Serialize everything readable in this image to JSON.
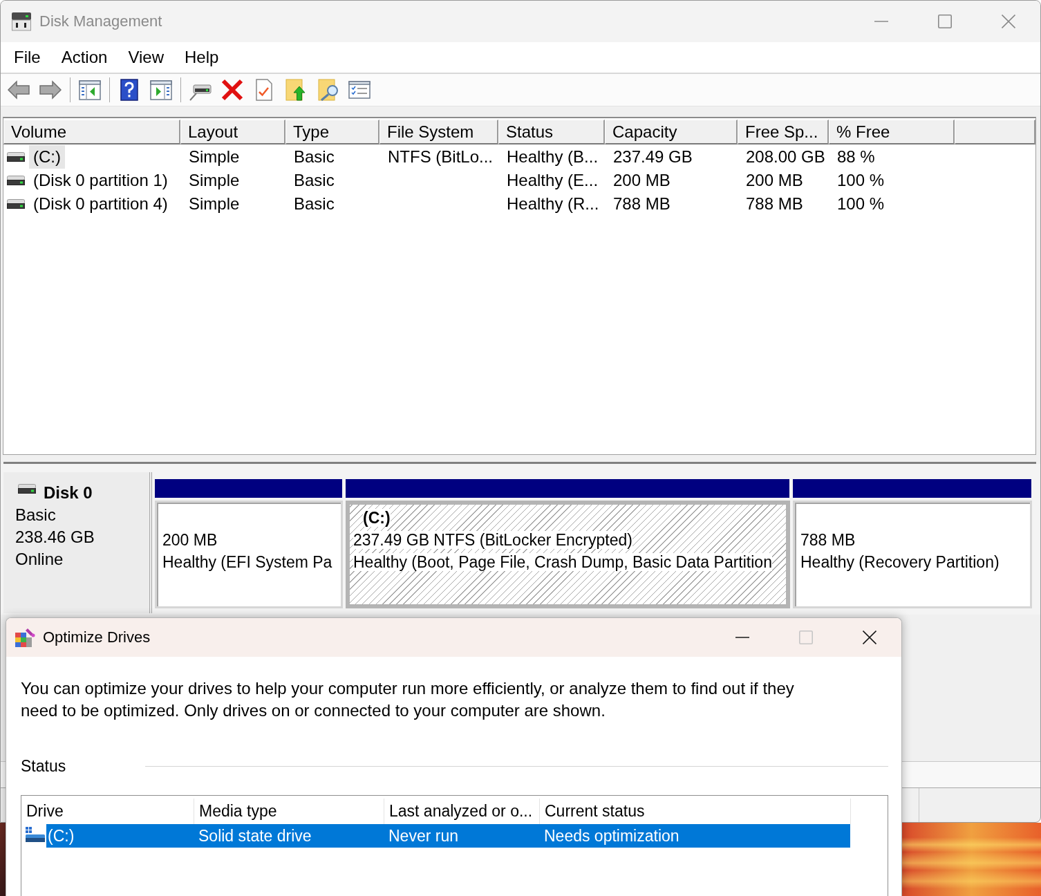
{
  "disk_management": {
    "title": "Disk Management",
    "active": false,
    "caption_buttons": [
      {
        "kind": "minimize",
        "disabled": false
      },
      {
        "kind": "maximize",
        "disabled": false
      },
      {
        "kind": "close",
        "disabled": false
      }
    ],
    "menu": [
      "File",
      "Action",
      "View",
      "Help"
    ],
    "toolbar": [
      [
        {
          "kind": "back",
          "disabled": true
        },
        {
          "kind": "forward",
          "disabled": true
        }
      ],
      [
        {
          "kind": "show-tree",
          "disabled": false
        }
      ],
      [
        {
          "kind": "help",
          "disabled": false
        },
        {
          "kind": "action-pane",
          "disabled": false
        }
      ],
      [
        {
          "kind": "connect",
          "disabled": false
        },
        {
          "kind": "delete",
          "disabled": false
        },
        {
          "kind": "properties",
          "disabled": false
        },
        {
          "kind": "open-folder",
          "disabled": false
        },
        {
          "kind": "explore",
          "disabled": false
        },
        {
          "kind": "settings-list",
          "disabled": false
        }
      ]
    ],
    "volumes": {
      "columns": [
        "Volume",
        "Layout",
        "Type",
        "File System",
        "Status",
        "Capacity",
        "Free Sp...",
        "% Free"
      ],
      "rows": [
        {
          "selected": true,
          "volume": "(C:)",
          "layout": "Simple",
          "type": "Basic",
          "file_system": "NTFS (BitLo...",
          "status": "Healthy (B...",
          "capacity": "237.49 GB",
          "free_space": "208.00 GB",
          "percent_free": "88 %"
        },
        {
          "selected": false,
          "volume": "(Disk 0 partition 1)",
          "layout": "Simple",
          "type": "Basic",
          "status": "Healthy (E...",
          "capacity": "200 MB",
          "free_space": "200 MB",
          "percent_free": "100 %"
        },
        {
          "selected": false,
          "volume": "(Disk 0 partition 4)",
          "layout": "Simple",
          "type": "Basic",
          "status": "Healthy (R...",
          "capacity": "788 MB",
          "free_space": "788 MB",
          "percent_free": "100 %"
        }
      ]
    },
    "disks": [
      {
        "name": "Disk 0",
        "type": "Basic",
        "size": "238.46 GB",
        "state": "Online",
        "partitions": [
          {
            "selected": false,
            "size": "200 MB",
            "status": "Healthy (EFI System Pa"
          },
          {
            "selected": true,
            "name": "(C:)",
            "size": "237.49 GB NTFS (BitLocker Encrypted)",
            "status": "Healthy (Boot, Page File, Crash Dump, Basic Data Partition"
          },
          {
            "selected": false,
            "size": "788 MB",
            "status": "Healthy (Recovery Partition)"
          }
        ]
      }
    ]
  },
  "optimize_drives": {
    "title": "Optimize Drives",
    "active": true,
    "caption_buttons": [
      {
        "kind": "minimize",
        "disabled": false
      },
      {
        "kind": "maximize",
        "disabled": true
      },
      {
        "kind": "close",
        "disabled": false
      }
    ],
    "description": "You can optimize your drives to help your computer run more efficiently, or analyze them to find out if they need to be optimized. Only drives on or connected to your computer are shown.",
    "status_label": "Status",
    "drives": {
      "columns": [
        "Drive",
        "Media type",
        "Last analyzed or o...",
        "Current status"
      ],
      "rows": [
        {
          "selected": true,
          "drive": "(C:)",
          "media_type": "Solid state drive",
          "last_analyzed": "Never run",
          "current_status": "Needs optimization"
        }
      ]
    }
  }
}
